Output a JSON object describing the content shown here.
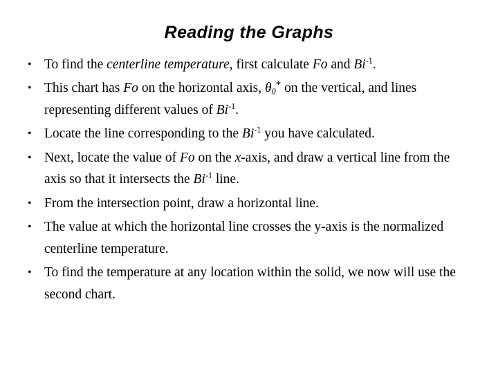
{
  "slide": {
    "title": "Reading the Graphs",
    "background_color": "#ffffff",
    "text_color": "#000000",
    "bullet_marker": "•",
    "bullets": [
      {
        "id": "bullet-1",
        "plain_text": "To find the centerline temperature, first calculate Fo and Bi-1.",
        "segments": [
          {
            "type": "plain",
            "text": "To find the "
          },
          {
            "type": "italic",
            "text": "centerline temperature"
          },
          {
            "type": "plain",
            "text": ", first calculate "
          },
          {
            "type": "italic",
            "text": "Fo"
          },
          {
            "type": "plain",
            "text": " and "
          },
          {
            "type": "italic",
            "text": "Bi"
          },
          {
            "type": "sup",
            "text": "-1"
          },
          {
            "type": "plain",
            "text": "."
          }
        ]
      },
      {
        "id": "bullet-2",
        "plain_text": "This chart has Fo on the horizontal axis, θ0* on the vertical, and lines representing different values of Bi-1.",
        "segments": [
          {
            "type": "plain",
            "text": "This chart has "
          },
          {
            "type": "italic",
            "text": "Fo"
          },
          {
            "type": "plain",
            "text": " on the horizontal axis, "
          },
          {
            "type": "theta",
            "text": "θ"
          },
          {
            "type": "sub",
            "text": "0"
          },
          {
            "type": "star",
            "text": "*"
          },
          {
            "type": "plain",
            "text": " on the vertical, and lines representing different values of "
          },
          {
            "type": "italic",
            "text": "Bi"
          },
          {
            "type": "sup",
            "text": "-1"
          },
          {
            "type": "plain",
            "text": "."
          }
        ]
      },
      {
        "id": "bullet-3",
        "plain_text": "Locate the line corresponding to the Bi-1 you have calculated.",
        "segments": [
          {
            "type": "plain",
            "text": "Locate the line corresponding to the "
          },
          {
            "type": "italic",
            "text": "Bi"
          },
          {
            "type": "sup",
            "text": "-1"
          },
          {
            "type": "plain",
            "text": " you have calculated."
          }
        ]
      },
      {
        "id": "bullet-4",
        "plain_text": "Next, locate the value of Fo on the x-axis, and draw a vertical line from the axis so that it intersects the Bi-1 line.",
        "segments": [
          {
            "type": "plain",
            "text": "Next, locate the value of "
          },
          {
            "type": "italic",
            "text": "Fo"
          },
          {
            "type": "plain",
            "text": " on the "
          },
          {
            "type": "italic",
            "text": "x"
          },
          {
            "type": "plain",
            "text": "-axis, and draw a vertical line from the axis so that it intersects the "
          },
          {
            "type": "italic",
            "text": "Bi"
          },
          {
            "type": "sup",
            "text": "-1"
          },
          {
            "type": "plain",
            "text": " line."
          }
        ]
      },
      {
        "id": "bullet-5",
        "plain_text": "From the intersection point, draw a horizontal line.",
        "segments": [
          {
            "type": "plain",
            "text": "From the intersection point, draw a horizontal line."
          }
        ]
      },
      {
        "id": "bullet-6",
        "plain_text": "The value at which the horizontal line crosses the y-axis is the normalized centerline temperature.",
        "segments": [
          {
            "type": "plain",
            "text": "The value at which the horizontal line crosses the y-axis is the normalized centerline temperature."
          }
        ]
      },
      {
        "id": "bullet-7",
        "plain_text": "To find the temperature at any location within the solid, we now will use the second chart.",
        "segments": [
          {
            "type": "plain",
            "text": "To find the temperature at any location within the solid, we now will use the second chart."
          }
        ]
      }
    ]
  }
}
